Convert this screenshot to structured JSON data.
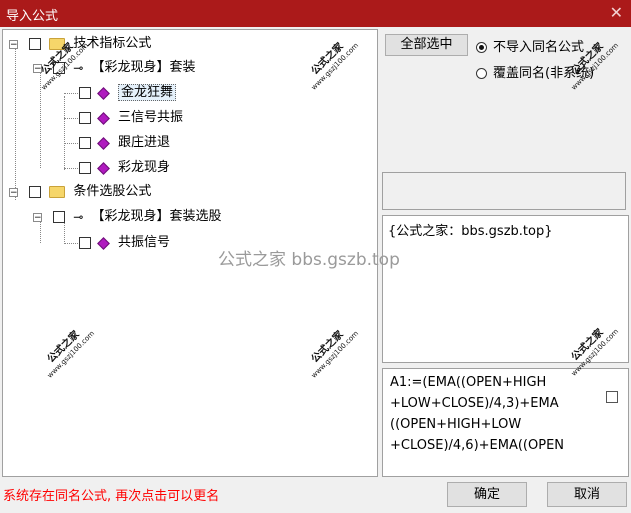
{
  "window": {
    "title": "导入公式",
    "close_glyph": "✕"
  },
  "tree": {
    "root1": {
      "label": "技术指标公式"
    },
    "group1": {
      "label": "【彩龙现身】套装"
    },
    "items1": [
      "金龙狂舞",
      "三信号共振",
      "跟庄进退",
      "彩龙现身"
    ],
    "root2": {
      "label": "条件选股公式"
    },
    "group2": {
      "label": "【彩龙现身】套装选股"
    },
    "items2": [
      "共振信号"
    ]
  },
  "buttons": {
    "select_all": "全部选中",
    "ok": "确定",
    "cancel": "取消"
  },
  "options": {
    "no_import_same_name": "不导入同名公式",
    "overwrite_same_name": "覆盖同名(非系统)",
    "selected": "no_import_same_name"
  },
  "description": "{公式之家：bbs.gszb.top}",
  "formula_text": "A1:=(EMA((OPEN+HIGH\n+LOW+CLOSE)/4,3)+EMA\n((OPEN+HIGH+LOW\n+CLOSE)/4,6)+EMA((OPEN",
  "status": "系统存在同名公式, 再次点击可以更名",
  "watermark": {
    "center": "公式之家 bbs.gszb.top",
    "stamp_title": "公式之家",
    "stamp_url": "www.gszj100.com"
  }
}
